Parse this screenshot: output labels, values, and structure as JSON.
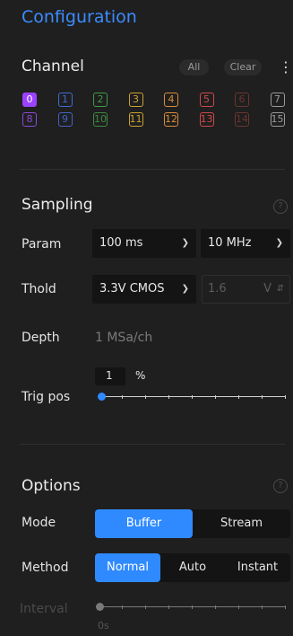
{
  "header": {
    "title": "Configuration"
  },
  "channel": {
    "title": "Channel",
    "all_label": "All",
    "clear_label": "Clear",
    "more_glyph": "⋮",
    "channels": [
      {
        "label": "0",
        "color": "#9b42ff",
        "selected": true
      },
      {
        "label": "1",
        "color": "#3d6bd6"
      },
      {
        "label": "2",
        "color": "#3f9a47"
      },
      {
        "label": "3",
        "color": "#c9a233"
      },
      {
        "label": "4",
        "color": "#d98c3a"
      },
      {
        "label": "5",
        "color": "#cf4949"
      },
      {
        "label": "6",
        "color": "#6d3430"
      },
      {
        "label": "7",
        "color": "#9a9a9a"
      },
      {
        "label": "8",
        "color": "#8a4bd8"
      },
      {
        "label": "9",
        "color": "#4263c4"
      },
      {
        "label": "10",
        "color": "#3d8a40"
      },
      {
        "label": "11",
        "color": "#c9a233"
      },
      {
        "label": "12",
        "color": "#d98c3a"
      },
      {
        "label": "13",
        "color": "#cf4949"
      },
      {
        "label": "14",
        "color": "#6d3430"
      },
      {
        "label": "15",
        "color": "#9a9a9a"
      }
    ]
  },
  "sampling": {
    "title": "Sampling",
    "help_glyph": "?",
    "param_label": "Param",
    "param_time": "100 ms",
    "param_rate": "10 MHz",
    "thold_label": "Thold",
    "thold_value": "3.3V CMOS",
    "thold_voltage": "1.6",
    "thold_unit": "V",
    "depth_label": "Depth",
    "depth_value": "1 MSa/ch",
    "trig_label": "Trig pos",
    "trig_value": "1",
    "trig_unit": "%",
    "trig_fraction": 0.01
  },
  "options": {
    "title": "Options",
    "help_glyph": "?",
    "mode_label": "Mode",
    "mode_options": [
      "Buffer",
      "Stream"
    ],
    "mode_selected": "Buffer",
    "method_label": "Method",
    "method_options": [
      "Normal",
      "Auto",
      "Instant"
    ],
    "method_selected": "Normal",
    "interval_label": "Interval",
    "interval_value": "0s"
  },
  "colors": {
    "accent": "#2f8aff",
    "title": "#3b8cff",
    "background": "#1f1f1f"
  }
}
